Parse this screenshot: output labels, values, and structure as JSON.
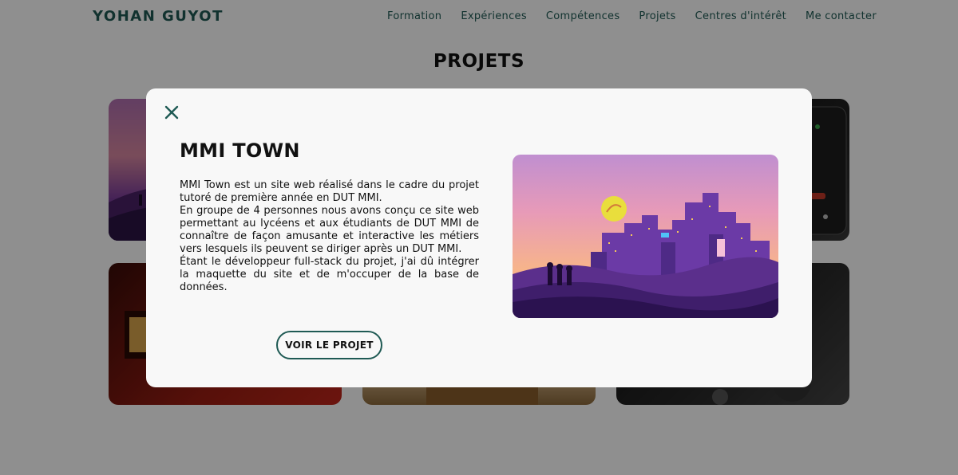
{
  "header": {
    "brand": "YOHAN GUYOT",
    "nav": [
      {
        "label": "Formation"
      },
      {
        "label": "Expériences"
      },
      {
        "label": "Compétences"
      },
      {
        "label": "Projets"
      },
      {
        "label": "Centres d'intérêt"
      },
      {
        "label": "Me contacter"
      }
    ]
  },
  "section": {
    "title": "PROJETS"
  },
  "modal": {
    "close_icon": "close-icon",
    "title": "MMI TOWN",
    "paragraphs": [
      "MMI Town est un site web réalisé dans le cadre du projet tutoré de première année en DUT MMI.",
      "En groupe de 4 personnes nous avons conçu ce site web permettant au lycéens et aux étudiants de DUT MMI de connaître de façon amusante et interactive les métiers vers lesquels ils peuvent se diriger après un DUT MMI.",
      "Étant le développeur full-stack du projet, j'ai dû intégrer la maquette du site et de m'occuper de la base de données."
    ],
    "cta_label": "VOIR LE PROJET"
  },
  "colors": {
    "accent": "#1f5a54",
    "overlay": "rgba(0,0,0,0.44)",
    "modal_bg": "#f8f8f8"
  }
}
